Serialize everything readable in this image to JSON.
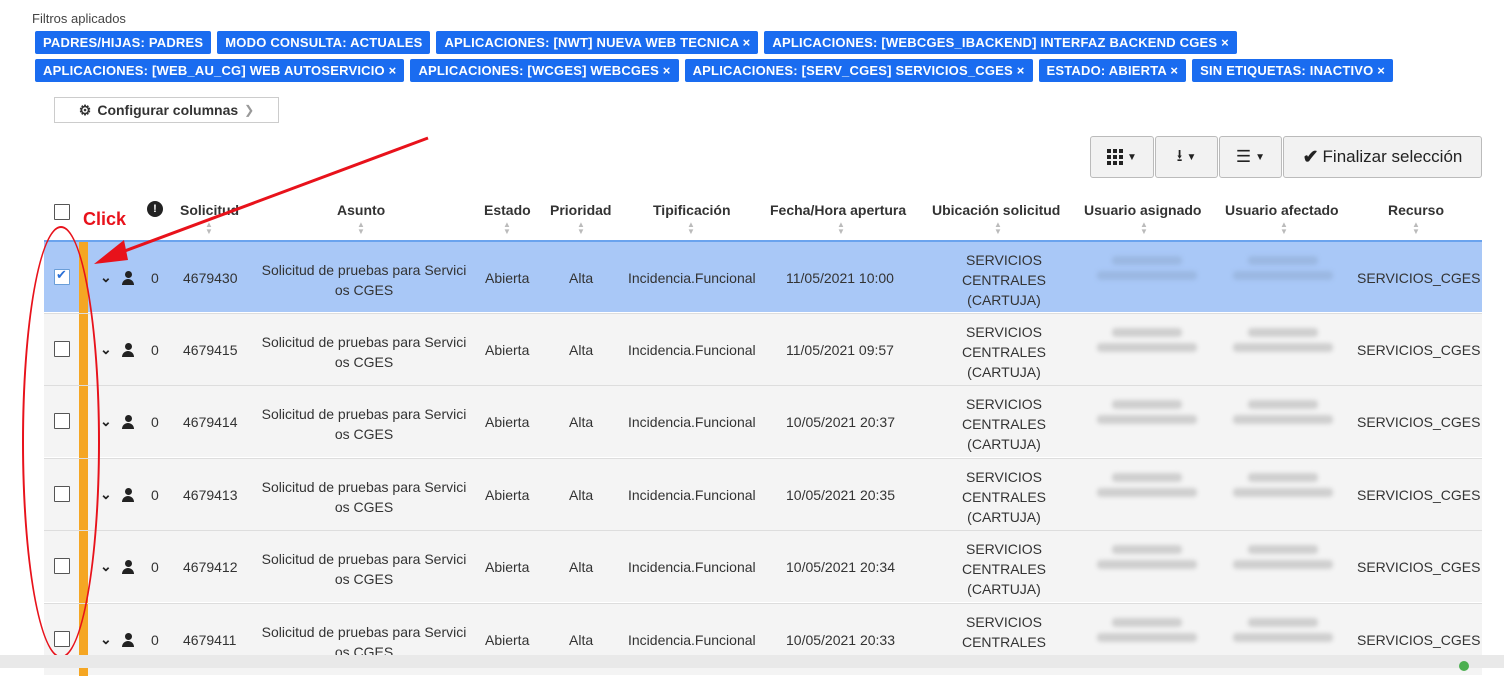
{
  "filters": {
    "title": "Filtros aplicados",
    "row1": [
      "PADRES/HIJAS: PADRES",
      "MODO CONSULTA: ACTUALES",
      "APLICACIONES: [NWT] NUEVA WEB TECNICA ×",
      "APLICACIONES: [WEBCGES_IBACKEND] INTERFAZ BACKEND CGES ×"
    ],
    "row2": [
      "APLICACIONES: [WEB_AU_CG] WEB AUTOSERVICIO ×",
      "APLICACIONES: [WCGES] WEBCGES ×",
      "APLICACIONES: [SERV_CGES] SERVICIOS_CGES ×",
      "ESTADO: ABIERTA ×",
      "SIN ETIQUETAS: INACTIVO ×"
    ]
  },
  "config_columns": {
    "label": "Configurar columnas",
    "icon": "gear-icon"
  },
  "toolbar": {
    "finish_label": "Finalizar selección",
    "icons": [
      "grid-icon",
      "download-icon",
      "checklist-icon",
      "check-icon"
    ]
  },
  "annotation": {
    "label": "Click",
    "color": "#e8121b"
  },
  "table": {
    "headers": [
      "!",
      "Solicitud",
      "Asunto",
      "Estado",
      "Prioridad",
      "Tipificación",
      "Fecha/Hora apertura",
      "Ubicación solicitud",
      "Usuario asignado",
      "Usuario afectado",
      "Recurso"
    ],
    "rows": [
      {
        "checked": true,
        "count": "0",
        "id": "4679430",
        "asunto_l1": "Solicitud de pruebas para Servici",
        "asunto_l2": "os CGES",
        "estado": "Abierta",
        "prioridad": "Alta",
        "tipificacion": "Incidencia.Funcional",
        "fecha": "11/05/2021 10:00",
        "ubic_l1": "SERVICIOS",
        "ubic_l2": "CENTRALES",
        "ubic_l3": "(CARTUJA)",
        "recurso": "SERVICIOS_CGES"
      },
      {
        "checked": false,
        "count": "0",
        "id": "4679415",
        "asunto_l1": "Solicitud de pruebas para Servici",
        "asunto_l2": "os CGES",
        "estado": "Abierta",
        "prioridad": "Alta",
        "tipificacion": "Incidencia.Funcional",
        "fecha": "11/05/2021 09:57",
        "ubic_l1": "SERVICIOS",
        "ubic_l2": "CENTRALES",
        "ubic_l3": "(CARTUJA)",
        "recurso": "SERVICIOS_CGES"
      },
      {
        "checked": false,
        "count": "0",
        "id": "4679414",
        "asunto_l1": "Solicitud de pruebas para Servici",
        "asunto_l2": "os CGES",
        "estado": "Abierta",
        "prioridad": "Alta",
        "tipificacion": "Incidencia.Funcional",
        "fecha": "10/05/2021 20:37",
        "ubic_l1": "SERVICIOS",
        "ubic_l2": "CENTRALES",
        "ubic_l3": "(CARTUJA)",
        "recurso": "SERVICIOS_CGES"
      },
      {
        "checked": false,
        "count": "0",
        "id": "4679413",
        "asunto_l1": "Solicitud de pruebas para Servici",
        "asunto_l2": "os CGES",
        "estado": "Abierta",
        "prioridad": "Alta",
        "tipificacion": "Incidencia.Funcional",
        "fecha": "10/05/2021 20:35",
        "ubic_l1": "SERVICIOS",
        "ubic_l2": "CENTRALES",
        "ubic_l3": "(CARTUJA)",
        "recurso": "SERVICIOS_CGES"
      },
      {
        "checked": false,
        "count": "0",
        "id": "4679412",
        "asunto_l1": "Solicitud de pruebas para Servici",
        "asunto_l2": "os CGES",
        "estado": "Abierta",
        "prioridad": "Alta",
        "tipificacion": "Incidencia.Funcional",
        "fecha": "10/05/2021 20:34",
        "ubic_l1": "SERVICIOS",
        "ubic_l2": "CENTRALES",
        "ubic_l3": "(CARTUJA)",
        "recurso": "SERVICIOS_CGES"
      },
      {
        "checked": false,
        "count": "0",
        "id": "4679411",
        "asunto_l1": "Solicitud de pruebas para Servici",
        "asunto_l2": "os CGES",
        "estado": "Abierta",
        "prioridad": "Alta",
        "tipificacion": "Incidencia.Funcional",
        "fecha": "10/05/2021 20:33",
        "ubic_l1": "SERVICIOS",
        "ubic_l2": "CENTRALES",
        "ubic_l3": "",
        "recurso": "SERVICIOS_CGES"
      }
    ]
  }
}
